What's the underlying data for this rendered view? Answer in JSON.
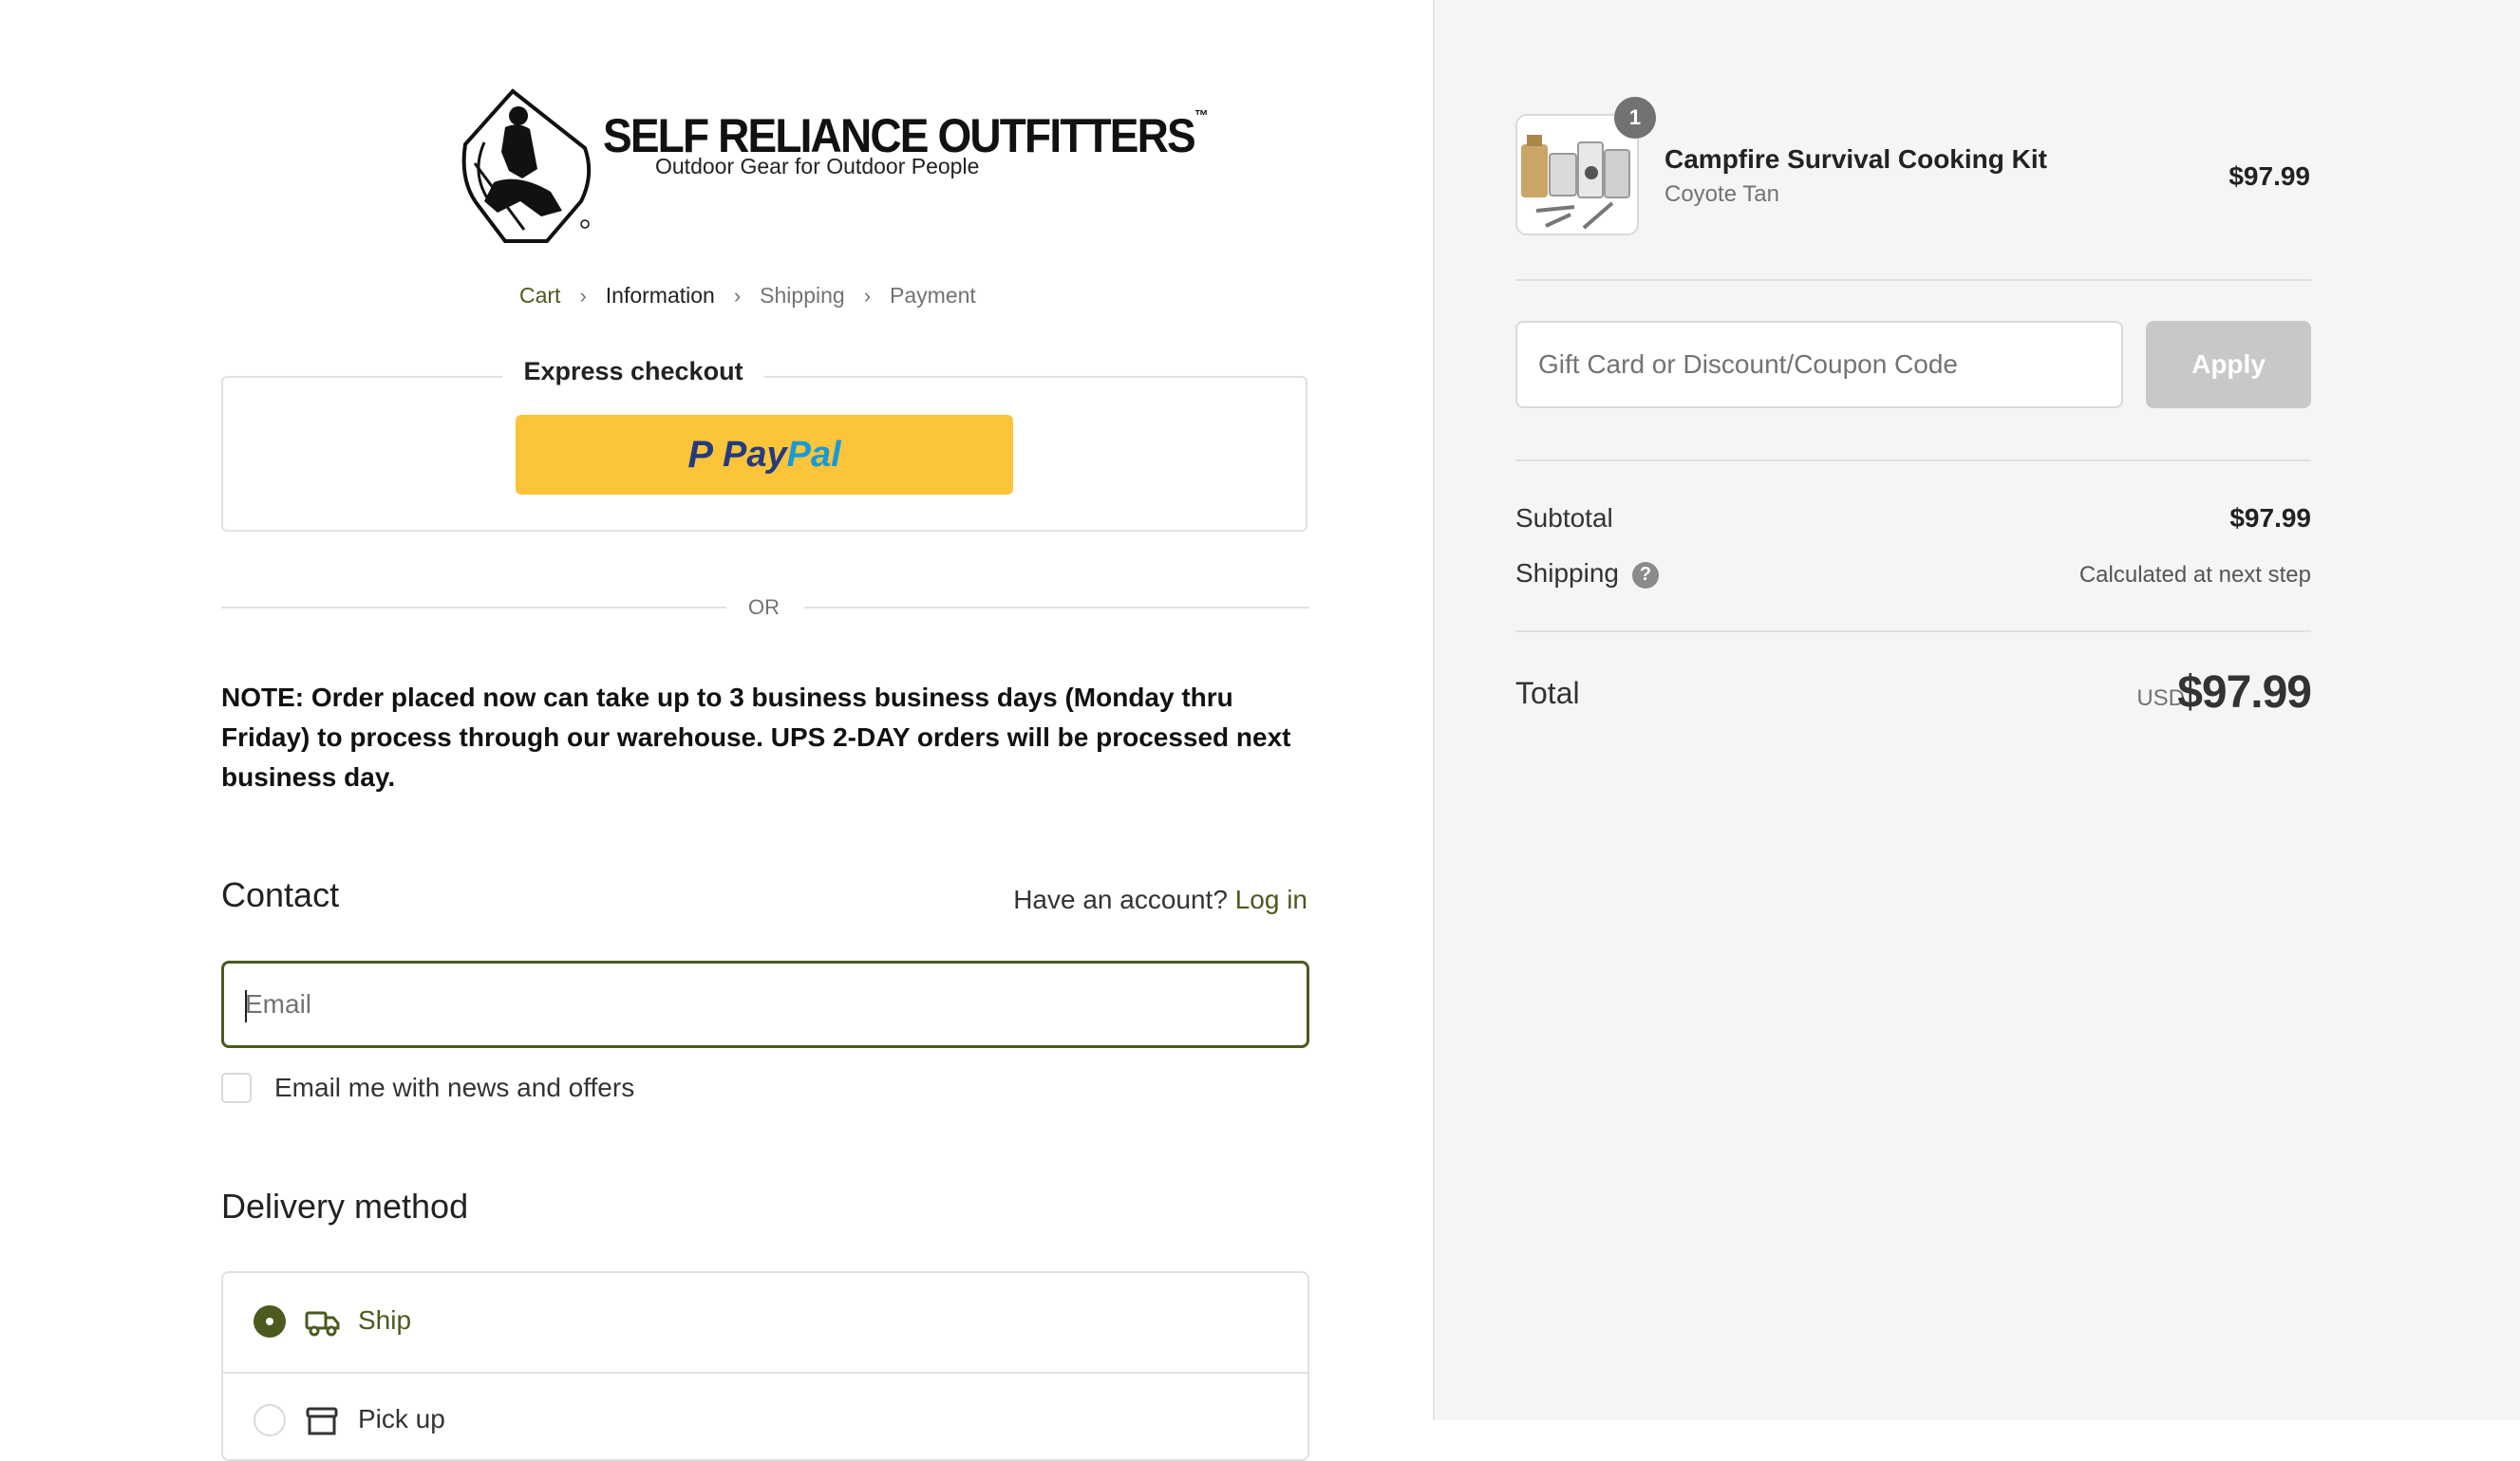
{
  "brand": {
    "name": "SELF RELIANCE OUTFITTERS",
    "trademark": "™",
    "tagline": "Outdoor Gear for Outdoor People"
  },
  "breadcrumb": [
    {
      "label": "Cart",
      "state": "link"
    },
    {
      "label": "Information",
      "state": "current"
    },
    {
      "label": "Shipping",
      "state": "upcoming"
    },
    {
      "label": "Payment",
      "state": "upcoming"
    }
  ],
  "express": {
    "title": "Express checkout",
    "paypal_pay": "Pay",
    "paypal_pal": "Pal"
  },
  "divider_text": "OR",
  "note": "NOTE: Order placed now can take up to 3 business business days (Monday thru Friday) to process through our warehouse. UPS 2-DAY orders will be processed next business day.",
  "contact": {
    "heading": "Contact",
    "account_prompt": "Have an account?",
    "login_label": "Log in",
    "email_placeholder": "Email",
    "email_value": "",
    "news_label": "Email me with news and offers",
    "news_checked": false
  },
  "delivery": {
    "heading": "Delivery method",
    "options": [
      {
        "label": "Ship",
        "selected": true,
        "icon": "truck-icon"
      },
      {
        "label": "Pick up",
        "selected": false,
        "icon": "store-icon"
      }
    ]
  },
  "summary": {
    "product": {
      "name": "Campfire Survival Cooking Kit",
      "variant": "Coyote Tan",
      "price": "$97.99",
      "quantity": "1"
    },
    "discount_placeholder": "Gift Card or Discount/Coupon Code",
    "apply_label": "Apply",
    "subtotal_label": "Subtotal",
    "subtotal_value": "$97.99",
    "shipping_label": "Shipping",
    "shipping_value": "Calculated at next step",
    "total_label": "Total",
    "currency": "USD",
    "total_value": "$97.99"
  },
  "colors": {
    "accent": "#4b5a1e",
    "paypal_yellow": "#fbc439",
    "sidebar_bg": "#f5f5f5"
  }
}
